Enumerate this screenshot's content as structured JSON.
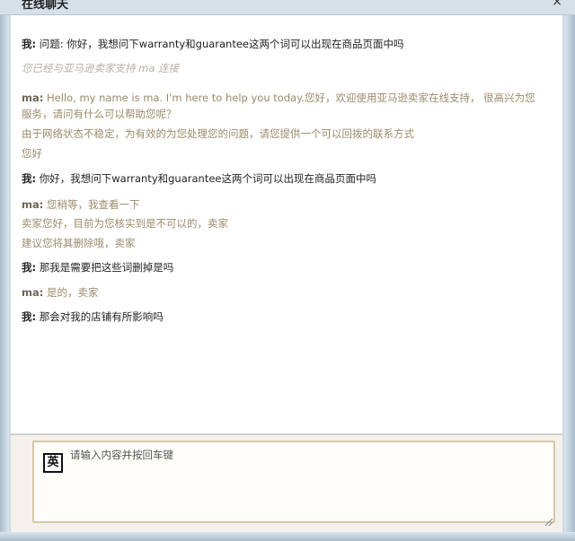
{
  "window": {
    "title": "在线聊天",
    "close_symbol": "×"
  },
  "chat": {
    "messages": [
      {
        "kind": "user",
        "sender": "我:",
        "text": " 问题: 你好，我想问下warranty和guarantee这两个词可以出现在商品页面中吗"
      },
      {
        "kind": "system-italic",
        "sender": "",
        "text": "您已经与亚马逊卖家支持 ma 连接"
      },
      {
        "kind": "agent",
        "sender": "ma:",
        "text": " Hello, my name is ma. I'm here to help you today.您好，欢迎使用亚马逊卖家在线支持， 很高兴为您"
      },
      {
        "kind": "agent-cont",
        "sender": "",
        "text": "服务，请问有什么可以帮助您呢？"
      },
      {
        "kind": "system",
        "sender": "",
        "text": "由于网络状态不稳定，为有效的为您处理您的问题，请您提供一个可以回拨的联系方式"
      },
      {
        "kind": "system",
        "sender": "",
        "text": "您好"
      },
      {
        "kind": "user",
        "sender": "我:",
        "text": " 你好，我想问下warranty和guarantee这两个词可以出现在商品页面中吗"
      },
      {
        "kind": "agent",
        "sender": "ma:",
        "text": " 您稍等，我查看一下"
      },
      {
        "kind": "agent-cont",
        "sender": "",
        "text": "卖家您好，目前为您核实到是不可以的，卖家"
      },
      {
        "kind": "agent-cont",
        "sender": "",
        "text": "建议您将其删除哦，卖家"
      },
      {
        "kind": "user",
        "sender": "我:",
        "text": " 那我是需要把这些词删掉是吗"
      },
      {
        "kind": "agent",
        "sender": "ma:",
        "text": " 是的，卖家"
      },
      {
        "kind": "user",
        "sender": "我:",
        "text": " 那会对我的店铺有所影响吗"
      }
    ]
  },
  "input": {
    "placeholder": "请输入内容并按回车键",
    "ime_indicator": "英"
  }
}
